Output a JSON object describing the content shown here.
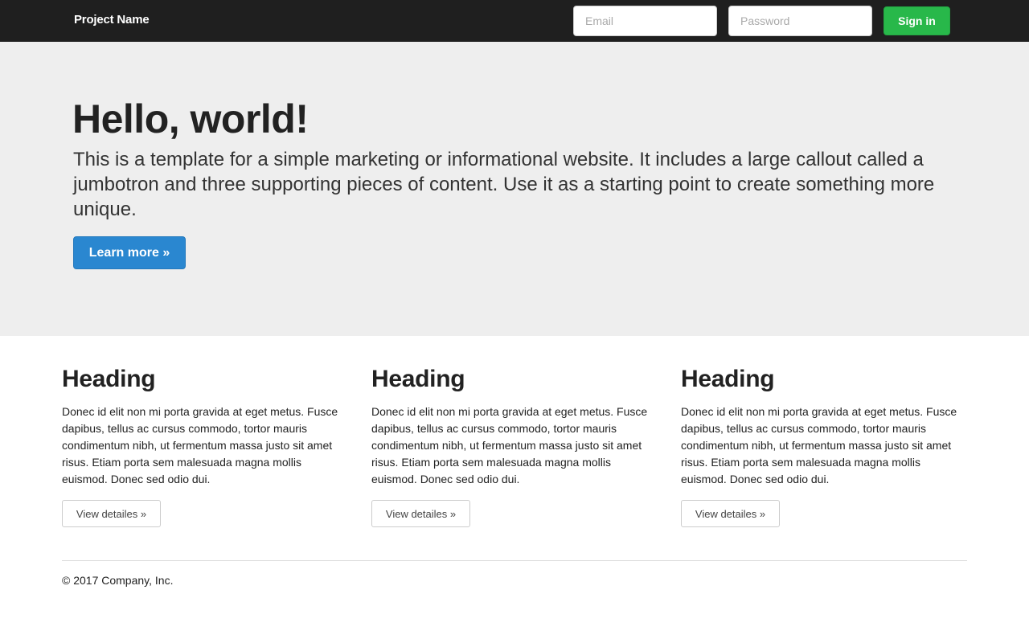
{
  "navbar": {
    "brand": "Project Name",
    "email_placeholder": "Email",
    "password_placeholder": "Password",
    "signin_label": "Sign in",
    "colors": {
      "background": "#1f1f1f",
      "signin": "#28b84a"
    }
  },
  "jumbotron": {
    "title": "Hello, world!",
    "lead": "This is a template for a simple marketing or informational website. It includes a large callout called a jumbotron and three supporting pieces of content. Use it as a starting point to create something more unique.",
    "button_label": "Learn more »",
    "colors": {
      "background": "#eeeeee",
      "button": "#2a87d0"
    }
  },
  "columns": [
    {
      "heading": "Heading",
      "text": "Donec id elit non mi porta gravida at eget metus. Fusce dapibus, tellus ac cursus commodo, tortor mauris condimentum nibh, ut fermentum massa justo sit amet risus. Etiam porta sem malesuada magna mollis euismod. Donec sed odio dui.",
      "button_label": "View detailes »"
    },
    {
      "heading": "Heading",
      "text": "Donec id elit non mi porta gravida at eget metus. Fusce dapibus, tellus ac cursus commodo, tortor mauris condimentum nibh, ut fermentum massa justo sit amet risus. Etiam porta sem malesuada magna mollis euismod. Donec sed odio dui.",
      "button_label": "View detailes »"
    },
    {
      "heading": "Heading",
      "text": "Donec id elit non mi porta gravida at eget metus. Fusce dapibus, tellus ac cursus commodo, tortor mauris condimentum nibh, ut fermentum massa justo sit amet risus. Etiam porta sem malesuada magna mollis euismod. Donec sed odio dui.",
      "button_label": "View detailes »"
    }
  ],
  "footer": {
    "text": "© 2017 Company, Inc."
  }
}
